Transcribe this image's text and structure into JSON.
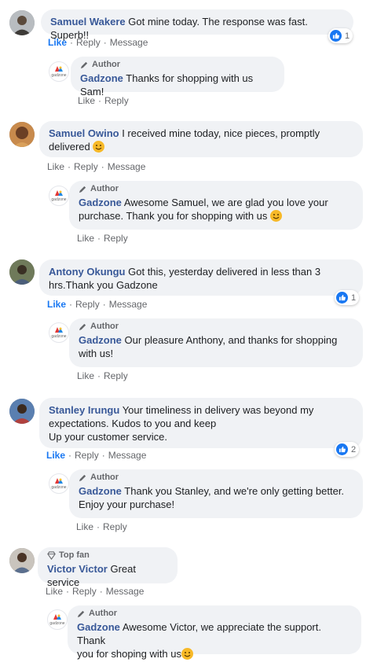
{
  "actions": {
    "like": "Like",
    "reply": "Reply",
    "message": "Message",
    "sep": "·"
  },
  "author_badge": "Author",
  "top_fan_badge": "Top fan",
  "page_name": "Gadzone",
  "page_logo_text": "gadzone",
  "threads": [
    {
      "comment": {
        "name": "Samuel Wakere",
        "text": "Got mine today. The response was fast. Superb!!",
        "reactions": "1"
      },
      "reply": {
        "text": "Thanks for shopping with us Sam!"
      }
    },
    {
      "comment": {
        "name": "Samuel Owino",
        "text_1": "I received mine today, nice pieces, promptly",
        "text_2": "delivered"
      },
      "reply": {
        "text_1": "Awesome Samuel, we are glad you love your",
        "text_2": "purchase. Thank you for shopping with us"
      }
    },
    {
      "comment": {
        "name": "Antony Okungu",
        "text_1": "Got this, yesterday delivered in less than 3",
        "text_2": "hrs.Thank you Gadzone",
        "reactions": "1"
      },
      "reply": {
        "text_1": "Our pleasure Anthony, and thanks for shopping",
        "text_2": "with us!"
      }
    },
    {
      "comment": {
        "name": "Stanley Irungu",
        "text_1": "Your timeliness in delivery was beyond my",
        "text_2": "expectations. Kudos to you and keep",
        "text_3": "Up your customer service.",
        "reactions": "2"
      },
      "reply": {
        "text_1": "Thank you Stanley, and we're only getting better.",
        "text_2": "Enjoy your purchase!"
      }
    },
    {
      "comment": {
        "name": "Victor Victor",
        "text": "Great service"
      },
      "reply": {
        "text_1": "Awesome Victor, we appreciate the support. Thank",
        "text_2": "you for shoping with us"
      }
    }
  ],
  "colors": {
    "name": "#385898",
    "like_active": "#1877f2",
    "bubble": "#f0f2f5",
    "meta": "#65676b"
  },
  "icons": [
    "thumbs-up-icon",
    "pencil-icon",
    "diamond-icon",
    "smile-emoji-icon"
  ]
}
